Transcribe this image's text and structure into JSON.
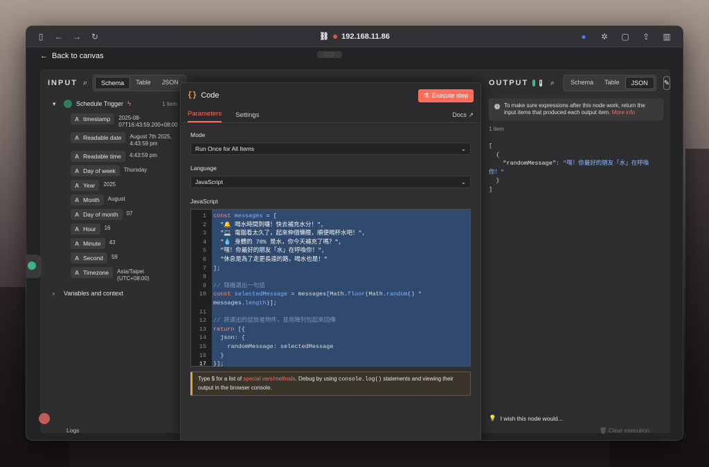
{
  "browser": {
    "address": "192.168.11.86"
  },
  "canvas": {
    "back_label": "Back to canvas"
  },
  "input": {
    "title": "INPUT",
    "tabs": [
      "Schema",
      "Table",
      "JSON"
    ],
    "active_tab": "Schema",
    "trigger_name": "Schedule Trigger",
    "item_count": "1 item",
    "fields": [
      {
        "type": "A",
        "key": "timestamp",
        "value": "2025-08-07T16:43:59.200+08:00"
      },
      {
        "type": "A",
        "key": "Readable date",
        "value": "August 7th 2025, 4:43:59 pm"
      },
      {
        "type": "A",
        "key": "Readable time",
        "value": "4:43:59 pm"
      },
      {
        "type": "A",
        "key": "Day of week",
        "value": "Thursday"
      },
      {
        "type": "A",
        "key": "Year",
        "value": "2025"
      },
      {
        "type": "A",
        "key": "Month",
        "value": "August"
      },
      {
        "type": "A",
        "key": "Day of month",
        "value": "07"
      },
      {
        "type": "A",
        "key": "Hour",
        "value": "16"
      },
      {
        "type": "A",
        "key": "Minute",
        "value": "43"
      },
      {
        "type": "A",
        "key": "Second",
        "value": "59"
      },
      {
        "type": "A",
        "key": "Timezone",
        "value": "Asia/Taipei (UTC+08:00)"
      }
    ],
    "variables_label": "Variables and context"
  },
  "node": {
    "title": "Code",
    "execute_label": "Execute step",
    "tabs": [
      "Parameters",
      "Settings"
    ],
    "docs_label": "Docs",
    "mode_label": "Mode",
    "mode_value": "Run Once for All Items",
    "language_label": "Language",
    "language_value": "JavaScript",
    "code_label": "JavaScript",
    "line_numbers": [
      "1",
      "2",
      "3",
      "4",
      "5",
      "6",
      "7",
      "8",
      "9",
      "10",
      "",
      "11",
      "12",
      "13",
      "14",
      "15",
      "16",
      "17"
    ],
    "tip_text_1": "Type $ for a list of ",
    "tip_link": "special vars/methods",
    "tip_text_2": ". Debug by using ",
    "tip_code": "console.log()",
    "tip_text_3": " statements and viewing their output in the browser console."
  },
  "output": {
    "title": "OUTPUT",
    "tabs": [
      "Schema",
      "Table",
      "JSON"
    ],
    "active_tab": "JSON",
    "notice": "To make sure expressions after this node work, return the input items that produced each output item.",
    "notice_link": "More info",
    "item_count": "1 item",
    "json_key": "\"randomMessage\"",
    "json_value": "\"嘿！你最好的朋友「水」在呼喚你！\""
  },
  "footer": {
    "wish": "I wish this node would...",
    "logs": "Logs",
    "clear": "Clear execution"
  }
}
